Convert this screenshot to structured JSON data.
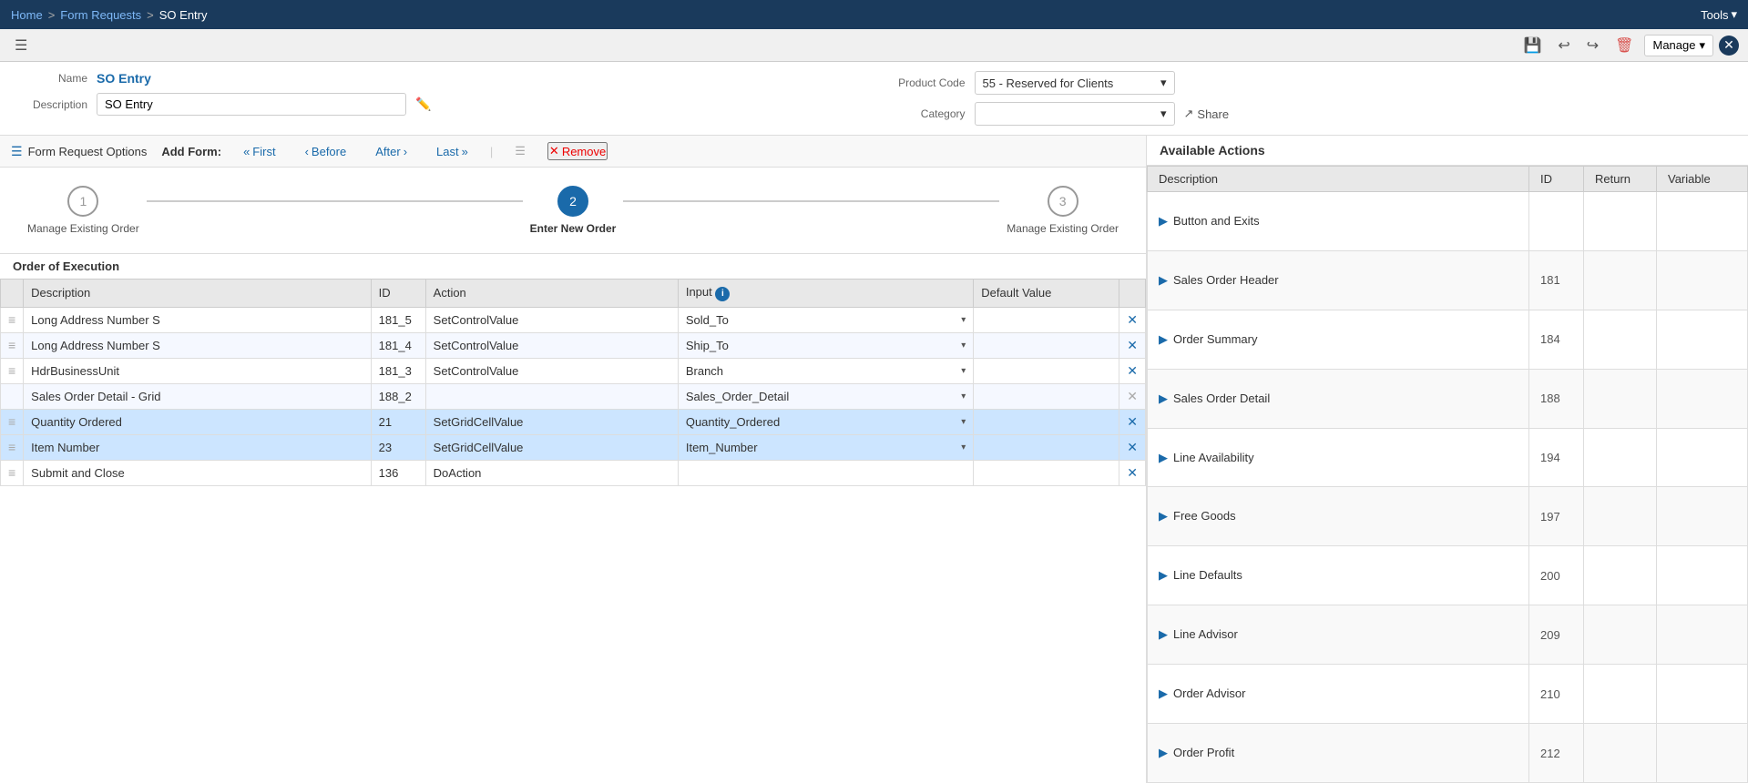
{
  "topnav": {
    "home": "Home",
    "form_requests": "Form Requests",
    "so_entry": "SO Entry",
    "tools": "Tools"
  },
  "toolbar": {
    "manage": "Manage",
    "save_icon": "💾",
    "undo_icon": "↩",
    "redo_icon": "↪",
    "clear_icon": "🗑"
  },
  "header": {
    "name_label": "Name",
    "name_value": "SO Entry",
    "description_label": "Description",
    "description_value": "SO Entry",
    "product_code_label": "Product Code",
    "product_code_value": "55 - Reserved for Clients",
    "category_label": "Category",
    "category_value": "",
    "share_label": "Share"
  },
  "form_options": {
    "title": "Form Request Options",
    "add_form": "Add Form:",
    "first": "First",
    "before": "Before",
    "after": "After",
    "last": "Last",
    "remove": "Remove"
  },
  "steps": [
    {
      "number": "1",
      "label": "Manage Existing Order",
      "active": false
    },
    {
      "number": "2",
      "label": "Enter New Order",
      "active": true
    },
    {
      "number": "3",
      "label": "Manage Existing Order",
      "active": false
    }
  ],
  "order_execution": {
    "title": "Order of Execution",
    "columns": [
      "",
      "Description",
      "ID",
      "Action",
      "Input",
      "",
      "Default Value",
      "",
      ""
    ],
    "rows": [
      {
        "drag": true,
        "description": "Long Address Number S",
        "id": "181_5",
        "action": "SetControlValue",
        "input": "Sold_To",
        "default": "",
        "removable": true,
        "selected": false
      },
      {
        "drag": true,
        "description": "Long Address Number S",
        "id": "181_4",
        "action": "SetControlValue",
        "input": "Ship_To",
        "default": "",
        "removable": true,
        "selected": false
      },
      {
        "drag": true,
        "description": "HdrBusinessUnit",
        "id": "181_3",
        "action": "SetControlValue",
        "input": "Branch",
        "default": "",
        "removable": true,
        "selected": false
      },
      {
        "drag": false,
        "description": "Sales Order Detail - Grid",
        "id": "188_2",
        "action": "",
        "input": "Sales_Order_Detail",
        "default": "",
        "removable": false,
        "selected": false
      },
      {
        "drag": true,
        "description": "Quantity Ordered",
        "id": "21",
        "action": "SetGridCellValue",
        "input": "Quantity_Ordered",
        "default": "",
        "removable": true,
        "selected": true
      },
      {
        "drag": true,
        "description": "Item Number",
        "id": "23",
        "action": "SetGridCellValue",
        "input": "Item_Number",
        "default": "",
        "removable": true,
        "selected": true
      },
      {
        "drag": true,
        "description": "Submit and Close",
        "id": "136",
        "action": "DoAction",
        "input": "",
        "default": "",
        "removable": true,
        "selected": false
      }
    ]
  },
  "available_actions": {
    "title": "Available Actions",
    "columns": [
      "Description",
      "ID",
      "Return",
      "Variable"
    ],
    "rows": [
      {
        "label": "Button and Exits",
        "id": "",
        "return": "",
        "variable": ""
      },
      {
        "label": "Sales Order Header",
        "id": "181",
        "return": "",
        "variable": ""
      },
      {
        "label": "Order Summary",
        "id": "184",
        "return": "",
        "variable": ""
      },
      {
        "label": "Sales Order Detail",
        "id": "188",
        "return": "",
        "variable": ""
      },
      {
        "label": "Line Availability",
        "id": "194",
        "return": "",
        "variable": ""
      },
      {
        "label": "Free Goods",
        "id": "197",
        "return": "",
        "variable": ""
      },
      {
        "label": "Line Defaults",
        "id": "200",
        "return": "",
        "variable": ""
      },
      {
        "label": "Line Advisor",
        "id": "209",
        "return": "",
        "variable": ""
      },
      {
        "label": "Order Advisor",
        "id": "210",
        "return": "",
        "variable": ""
      },
      {
        "label": "Order Profit",
        "id": "212",
        "return": "",
        "variable": ""
      }
    ]
  }
}
